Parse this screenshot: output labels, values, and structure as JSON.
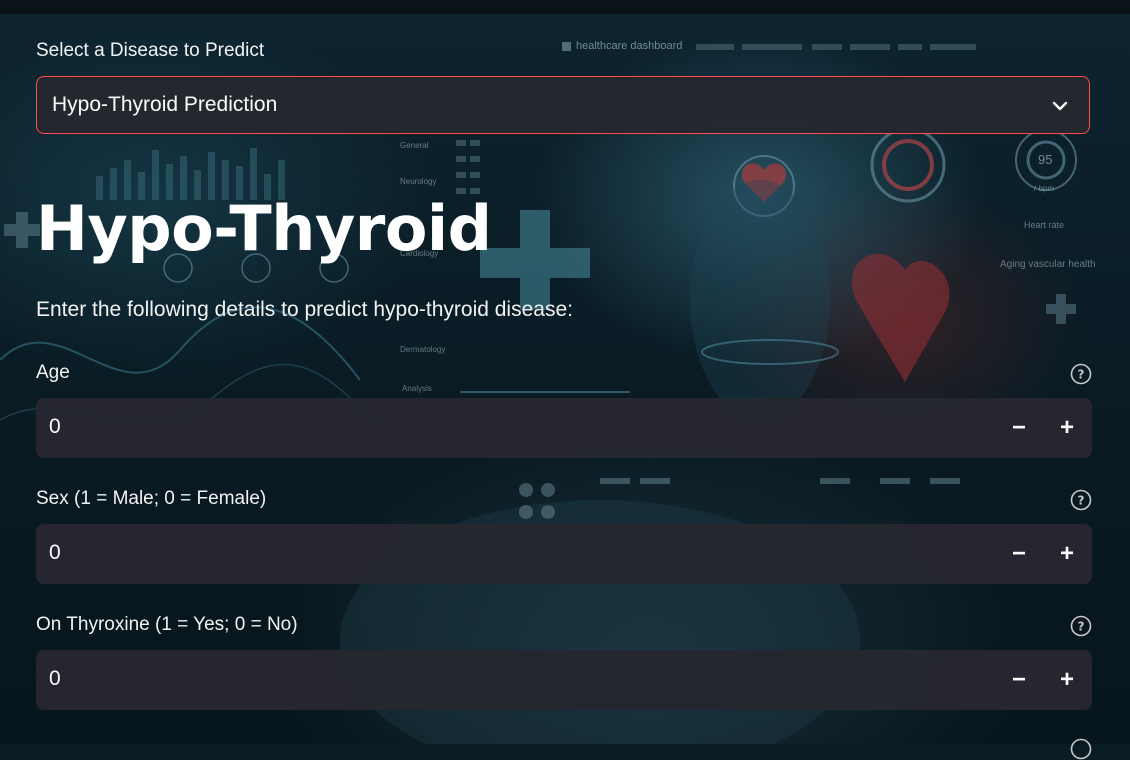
{
  "selector": {
    "label": "Select a Disease to Predict",
    "value": "Hypo-Thyroid Prediction"
  },
  "page": {
    "title": "Hypo-Thyroid",
    "instructions": "Enter the following details to predict hypo-thyroid disease:"
  },
  "fields": [
    {
      "label": "Age",
      "value": "0",
      "minus": "−",
      "plus": "+"
    },
    {
      "label": "Sex (1 = Male; 0 = Female)",
      "value": "0",
      "minus": "−",
      "plus": "+"
    },
    {
      "label": "On Thyroxine (1 = Yes; 0 = No)",
      "value": "0",
      "minus": "−",
      "plus": "+"
    }
  ],
  "background_text": {
    "dashboard": "healthcare dashboard",
    "general": "General",
    "neurology": "Neurology",
    "cardiology": "Cardiology",
    "dermatology": "Dermatology",
    "analysis": "Analysis",
    "bpm": "95",
    "bpm_unit": "/ bpm",
    "heart_rate": "Heart rate",
    "vascular": "Aging vascular health"
  },
  "colors": {
    "accent": "#ff4b4b",
    "input_bg": "#262730",
    "text": "#fafafa"
  }
}
